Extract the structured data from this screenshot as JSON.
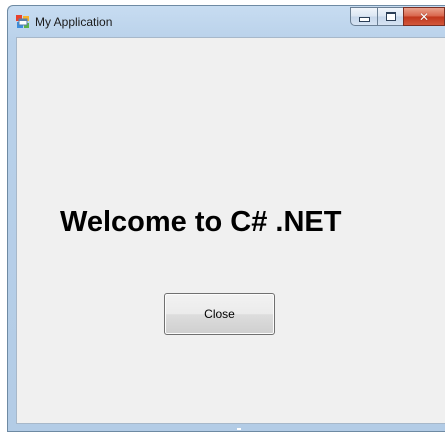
{
  "window": {
    "title": "My Application",
    "icon": "windows-form-icon",
    "caption_buttons": [
      {
        "name": "minimize",
        "icon": "minimize-icon"
      },
      {
        "name": "maximize",
        "icon": "maximize-icon"
      },
      {
        "name": "close",
        "icon": "close-icon",
        "glyph": "✕"
      }
    ]
  },
  "form": {
    "heading": "Welcome to C# .NET",
    "close_button_label": "Close"
  },
  "colors": {
    "frame": "#b9d1ea",
    "client_background": "#f0f0f0",
    "close_caption": "#c0361c"
  }
}
